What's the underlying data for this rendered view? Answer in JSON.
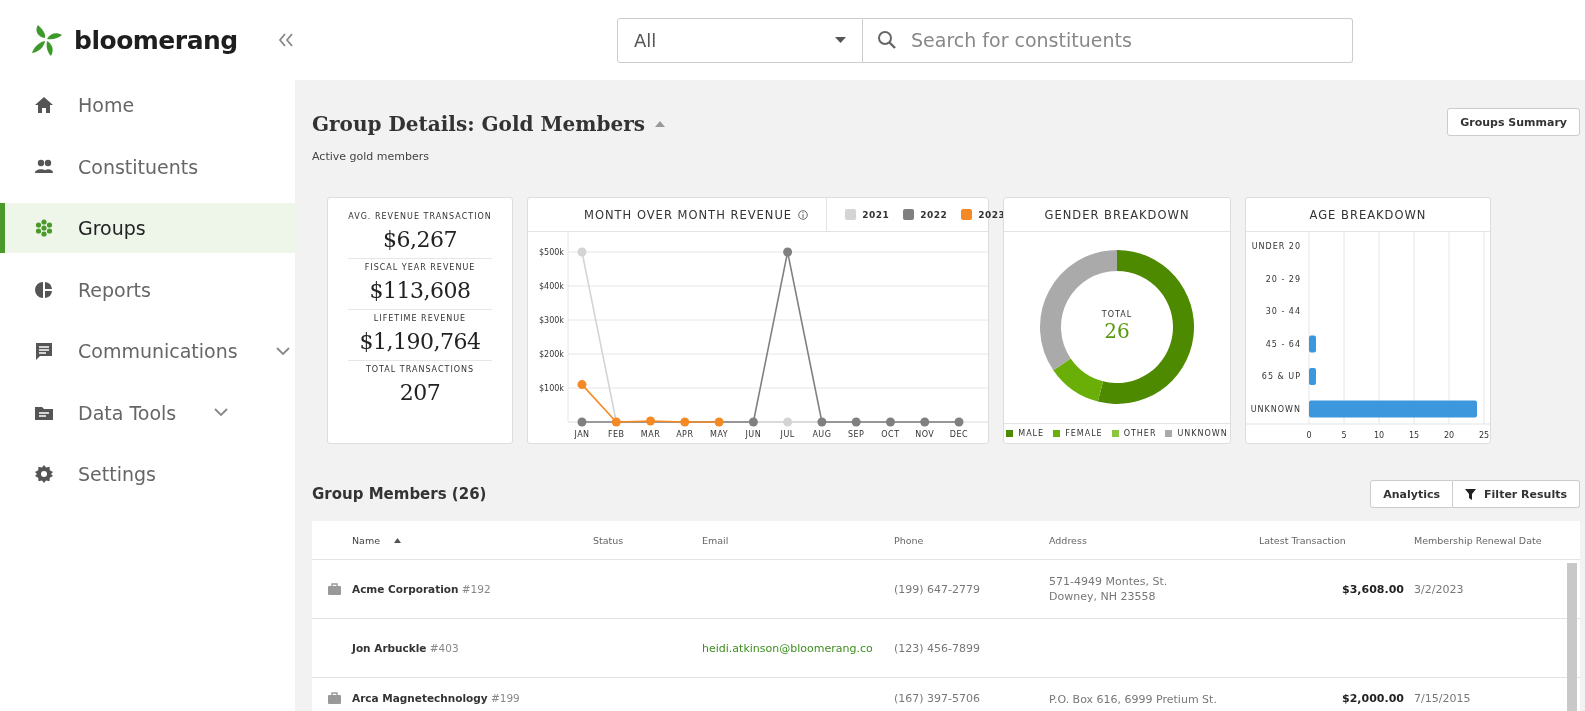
{
  "sidebar": {
    "brand": "bloomerang",
    "items": [
      {
        "label": "Home",
        "selected": false,
        "expandable": false
      },
      {
        "label": "Constituents",
        "selected": false,
        "expandable": false
      },
      {
        "label": "Groups",
        "selected": true,
        "expandable": false
      },
      {
        "label": "Reports",
        "selected": false,
        "expandable": false
      },
      {
        "label": "Communications",
        "selected": false,
        "expandable": true
      },
      {
        "label": "Data Tools",
        "selected": false,
        "expandable": true
      },
      {
        "label": "Settings",
        "selected": false,
        "expandable": false
      }
    ]
  },
  "search": {
    "scope": "All",
    "placeholder": "Search for constituents"
  },
  "page": {
    "title": "Group Details: Gold Members",
    "subtitle": "Active gold members",
    "summary_button": "Groups Summary"
  },
  "stats": [
    {
      "label": "AVG. REVENUE TRANSACTION",
      "value": "$6,267"
    },
    {
      "label": "FISCAL YEAR REVENUE",
      "value": "$113,608"
    },
    {
      "label": "LIFETIME REVENUE",
      "value": "$1,190,764"
    },
    {
      "label": "TOTAL TRANSACTIONS",
      "value": "207"
    }
  ],
  "revenue": {
    "title": "MONTH OVER MONTH REVENUE",
    "chart_data": {
      "type": "line",
      "grid": true,
      "categories": [
        "JAN",
        "FEB",
        "MAR",
        "APR",
        "MAY",
        "JUN",
        "JUL",
        "AUG",
        "SEP",
        "OCT",
        "NOV",
        "DEC"
      ],
      "ylim": [
        0,
        500000
      ],
      "yticks": [
        {
          "value": 100000,
          "label": "$100k"
        },
        {
          "value": 200000,
          "label": "$200k"
        },
        {
          "value": 300000,
          "label": "$300k"
        },
        {
          "value": 400000,
          "label": "$400k"
        },
        {
          "value": 500000,
          "label": "$500k"
        }
      ],
      "series": [
        {
          "name": "2021",
          "color": "#d4d4d4",
          "marker": true,
          "values": [
            500000,
            0,
            0,
            0,
            0,
            0,
            0,
            0,
            0,
            0,
            0,
            0
          ]
        },
        {
          "name": "2022",
          "color": "#808080",
          "marker": true,
          "values": [
            0,
            0,
            0,
            0,
            0,
            0,
            500000,
            0,
            0,
            0,
            0,
            0
          ]
        },
        {
          "name": "2023",
          "color": "#f58a25",
          "marker": true,
          "values": [
            110000,
            0,
            3000,
            0,
            0,
            null,
            null,
            null,
            null,
            null,
            null,
            null
          ]
        }
      ]
    }
  },
  "gender": {
    "title": "GENDER BREAKDOWN",
    "total_label": "TOTAL",
    "total": "26",
    "legend": [
      {
        "label": "MALE",
        "color": "#4e8a00"
      },
      {
        "label": "FEMALE",
        "color": "#6aaf08"
      },
      {
        "label": "OTHER",
        "color": "#8cc63f"
      },
      {
        "label": "UNKNOWN",
        "color": "#aaaaaa"
      }
    ],
    "chart_data": {
      "type": "donut",
      "values": [
        54,
        11.5,
        0,
        34.5
      ]
    }
  },
  "age": {
    "title": "AGE BREAKDOWN",
    "chart_data": {
      "type": "bar",
      "orientation": "horizontal",
      "grid": true,
      "categories": [
        "UNDER 20",
        "20 - 29",
        "30 - 44",
        "45 - 64",
        "65 & UP",
        "UNKNOWN"
      ],
      "values": [
        0,
        0,
        0,
        1,
        1,
        24
      ],
      "xlim": [
        0,
        25
      ],
      "xticks": [
        0,
        5,
        10,
        15,
        20,
        25
      ]
    }
  },
  "members": {
    "title": "Group Members (26)",
    "buttons": [
      "Analytics",
      "Filter Results"
    ],
    "columns": [
      {
        "label": "Name",
        "sorted": true
      },
      {
        "label": "Status",
        "sorted": false
      },
      {
        "label": "Email",
        "sorted": false
      },
      {
        "label": "Phone",
        "sorted": false
      },
      {
        "label": "Address",
        "sorted": false
      },
      {
        "label": "Latest Transaction",
        "sorted": false
      },
      {
        "label": "Membership Renewal Date",
        "sorted": false
      }
    ],
    "rows": [
      {
        "kind": "organization",
        "name": "**Acme Corporation** #192",
        "phone": "(199) 647-2779",
        "address": [
          "571-4949 Montes, St.",
          "Downey, NH 23558"
        ],
        "latest": "$3,608.00",
        "renewal": "3/2/2023"
      },
      {
        "kind": "person",
        "name": "**Jon Arbuckle** #403",
        "email": "heidi.atkinson@bloomerang.co",
        "phone": "(123) 456-7899"
      },
      {
        "kind": "organization",
        "name": "**Arca Magnetechnology** #199",
        "phone": "(167) 397-5706",
        "address": [
          "P.O. Box 616, 6999 Pretium St."
        ],
        "latest": "$2,000.00",
        "renewal": "7/15/2015"
      }
    ]
  }
}
